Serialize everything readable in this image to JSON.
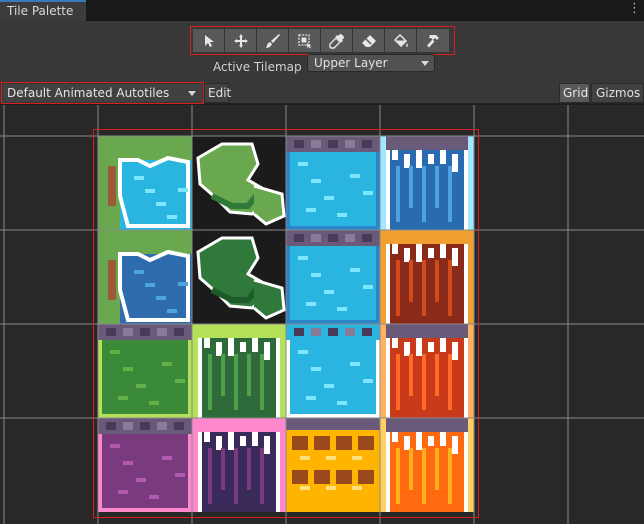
{
  "tab": {
    "title": "Tile Palette"
  },
  "toolbar": {
    "tools": [
      {
        "name": "select-tool",
        "icon": "arrow-icon"
      },
      {
        "name": "move-tool",
        "icon": "move-icon"
      },
      {
        "name": "paint-tool",
        "icon": "brush-icon"
      },
      {
        "name": "box-fill-tool",
        "icon": "box-fill-icon"
      },
      {
        "name": "picker-tool",
        "icon": "eyedropper-icon"
      },
      {
        "name": "erase-tool",
        "icon": "eraser-icon"
      },
      {
        "name": "fill-tool",
        "icon": "bucket-icon"
      },
      {
        "name": "hammer-tool",
        "icon": "hammer-icon"
      }
    ],
    "active_tilemap_label": "Active Tilemap",
    "active_tilemap_value": "Upper Layer"
  },
  "palette": {
    "selected": "Default Animated Autotiles",
    "edit_label": "Edit",
    "grid_label": "Grid",
    "gizmos_label": "Gizmos"
  },
  "tiles": [
    [
      "grass-water",
      "lilypad",
      "stone-water",
      "stone-icefall"
    ],
    [
      "grass-water-dark",
      "lilypad-dark",
      "stone-water",
      "stone-lavafall-dark"
    ],
    [
      "stone-grass",
      "grass-fall",
      "water-pool",
      "stone-lavafall"
    ],
    [
      "stone-poison",
      "poison-fall",
      "lava-rocks",
      "stone-lavafall-bright"
    ]
  ]
}
